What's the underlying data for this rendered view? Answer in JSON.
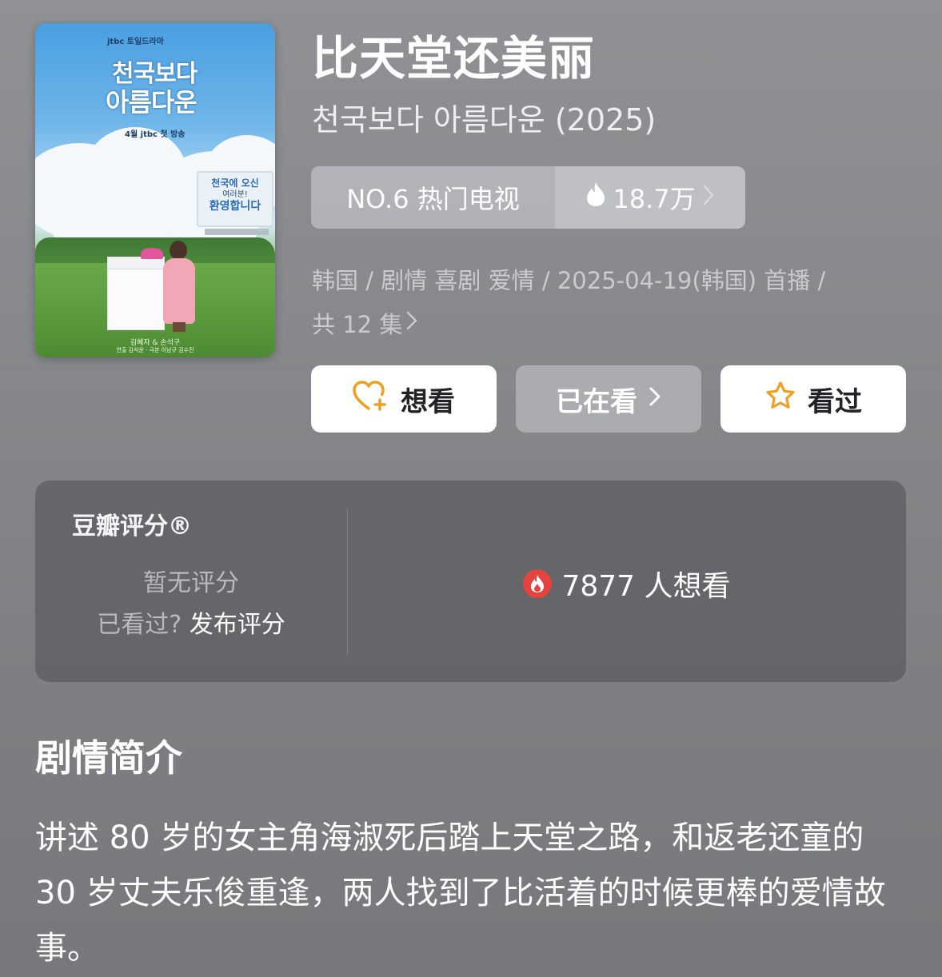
{
  "poster": {
    "network_top": "jtbc 토일드라마",
    "title_kr_line1": "천국보다",
    "title_kr_line2": "아름다운",
    "broadcast": "4월 jtbc 첫 방송",
    "billboard_line1": "천국에 오신",
    "billboard_line2": "여러분!",
    "billboard_line3": "환영합니다",
    "credits_line1": "김혜자 & 손석구",
    "credits_line2": "연출 김석윤 · 극본 이남규 김수진"
  },
  "title": "比天堂还美丽",
  "original_title": "천국보다 아름다운 (2025)",
  "rank": {
    "label": "NO.6 热门电视",
    "heat": "18.7万"
  },
  "meta": {
    "line1": "韩国 / 剧情 喜剧 爱情 / 2025-04-19(韩国) 首播 /",
    "line2": "共 12 集"
  },
  "actions": {
    "want": "想看",
    "watching": "已在看",
    "watched": "看过"
  },
  "rating": {
    "label": "豆瓣评分®",
    "none": "暂无评分",
    "prompt_question": "已看过?",
    "prompt_action": "发布评分",
    "want_count": "7877 人想看"
  },
  "synopsis": {
    "title": "剧情简介",
    "text": "讲述 80 岁的女主角海淑死后踏上天堂之路，和返老还童的 30 岁丈夫乐俊重逢，两人找到了比活着的时候更棒的爱情故事。"
  },
  "colors": {
    "accent_orange": "#f0a020",
    "fire_red": "#e5433e"
  }
}
